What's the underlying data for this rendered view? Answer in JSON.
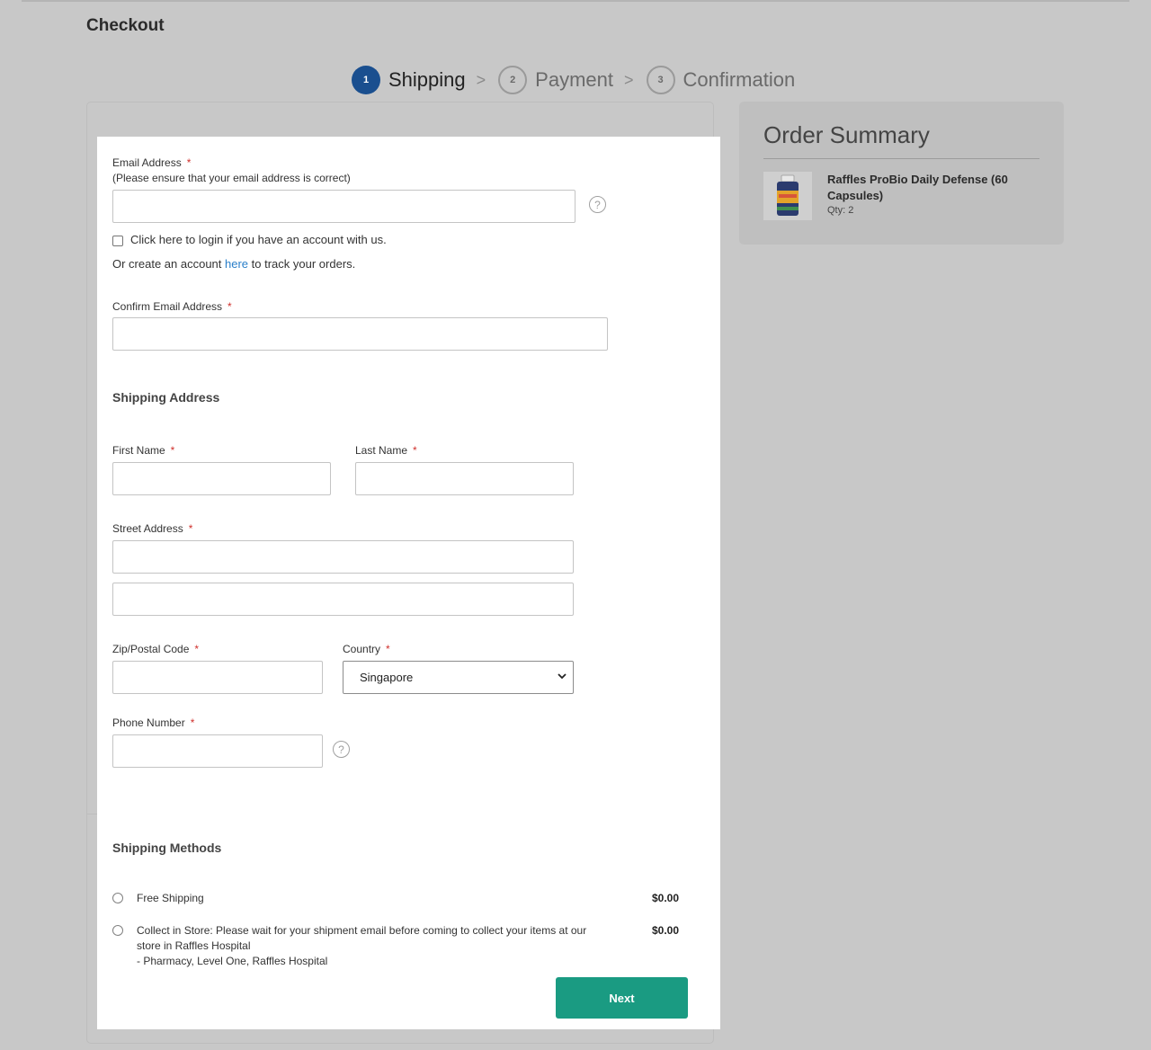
{
  "page": {
    "title": "Checkout"
  },
  "steps": [
    {
      "number": "1",
      "label": "Shipping",
      "active": true
    },
    {
      "number": "2",
      "label": "Payment",
      "active": false
    },
    {
      "number": "3",
      "label": "Confirmation",
      "active": false
    }
  ],
  "step_separator": ">",
  "form": {
    "email": {
      "label": "Email Address",
      "required_mark": "*",
      "note": "(Please ensure that your email address is correct)",
      "value": ""
    },
    "help_icon_glyph": "?",
    "login_checkbox_label": "Click here to login if you have an account with us.",
    "create_account": {
      "before": "Or create an account ",
      "link": "here",
      "after": " to track your orders."
    },
    "confirm_email": {
      "label": "Confirm Email Address",
      "required_mark": "*",
      "value": ""
    },
    "shipping_address_heading": "Shipping Address",
    "first_name": {
      "label": "First Name",
      "required_mark": "*",
      "value": ""
    },
    "last_name": {
      "label": "Last Name",
      "required_mark": "*",
      "value": ""
    },
    "street_address": {
      "label": "Street Address",
      "required_mark": "*",
      "line1": "",
      "line2": ""
    },
    "zip": {
      "label": "Zip/Postal Code",
      "required_mark": "*",
      "value": ""
    },
    "country": {
      "label": "Country",
      "required_mark": "*",
      "selected": "Singapore"
    },
    "phone": {
      "label": "Phone Number",
      "required_mark": "*",
      "value": ""
    }
  },
  "shipping_methods": {
    "heading": "Shipping Methods",
    "options": [
      {
        "name": "Free Shipping",
        "price": "$0.00",
        "selected": false
      },
      {
        "line1": "Collect in Store: Please wait for your shipment email before coming to collect your items at our",
        "line2": "store in Raffles Hospital",
        "line3": "- Pharmacy, Level One, Raffles Hospital",
        "price": "$0.00",
        "selected": false
      }
    ]
  },
  "next_button": "Next",
  "order_summary": {
    "title": "Order Summary",
    "items": [
      {
        "name": "Raffles ProBio Daily Defense (60 Capsules)",
        "qty": "Qty: 2"
      }
    ]
  },
  "colors": {
    "accent": "#1a4f8f",
    "button": "#1a9b82",
    "link": "#2a7fc9",
    "required": "#d0312d",
    "background": "#c8c8c8"
  }
}
